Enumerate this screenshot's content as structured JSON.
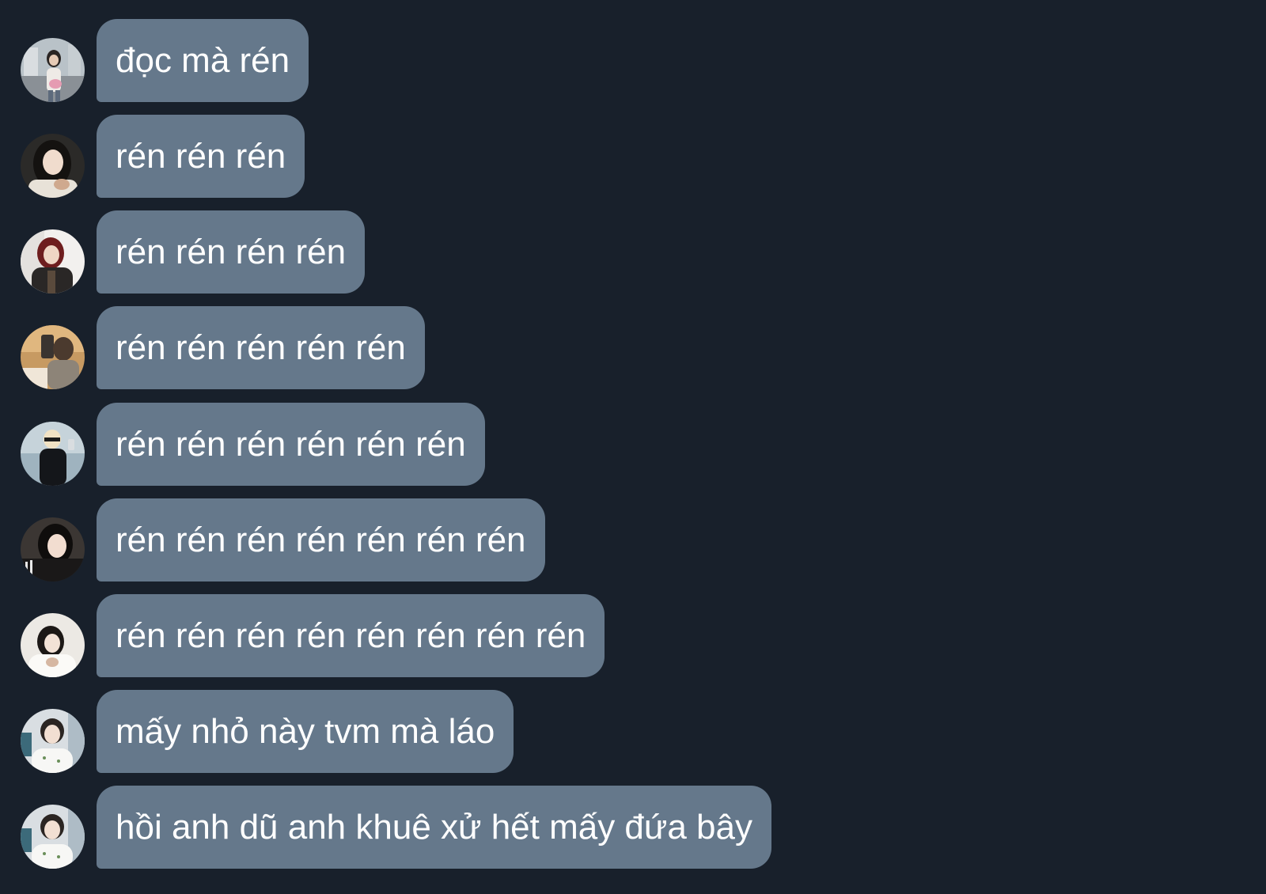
{
  "conversation": {
    "messages": [
      {
        "text": "đọc mà rén",
        "avatar": "girl-street-photo-avatar"
      },
      {
        "text": "rén rén rén",
        "avatar": "girl-long-dark-hair-avatar"
      },
      {
        "text": "rén rén rén rén",
        "avatar": "girl-red-hair-avatar"
      },
      {
        "text": "rén rén rén rén rén",
        "avatar": "mirror-selfie-avatar"
      },
      {
        "text": "rén rén rén rén rén rén",
        "avatar": "blonde-mirror-selfie-avatar"
      },
      {
        "text": "rén rén rén rén rén rén rén",
        "avatar": "girl-dark-jacket-avatar"
      },
      {
        "text": "rén rén rén rén rén rén rén rén",
        "avatar": "girl-white-outfit-avatar"
      },
      {
        "text": "mấy nhỏ này tvm mà láo",
        "avatar": "boy-white-shirt-avatar"
      },
      {
        "text": "hồi anh dũ anh khuê xử hết mấy đứa bây",
        "avatar": "boy-white-shirt-avatar"
      }
    ]
  },
  "colors": {
    "background": "#18202b",
    "bubble": "#65788b",
    "text": "#ffffff"
  }
}
